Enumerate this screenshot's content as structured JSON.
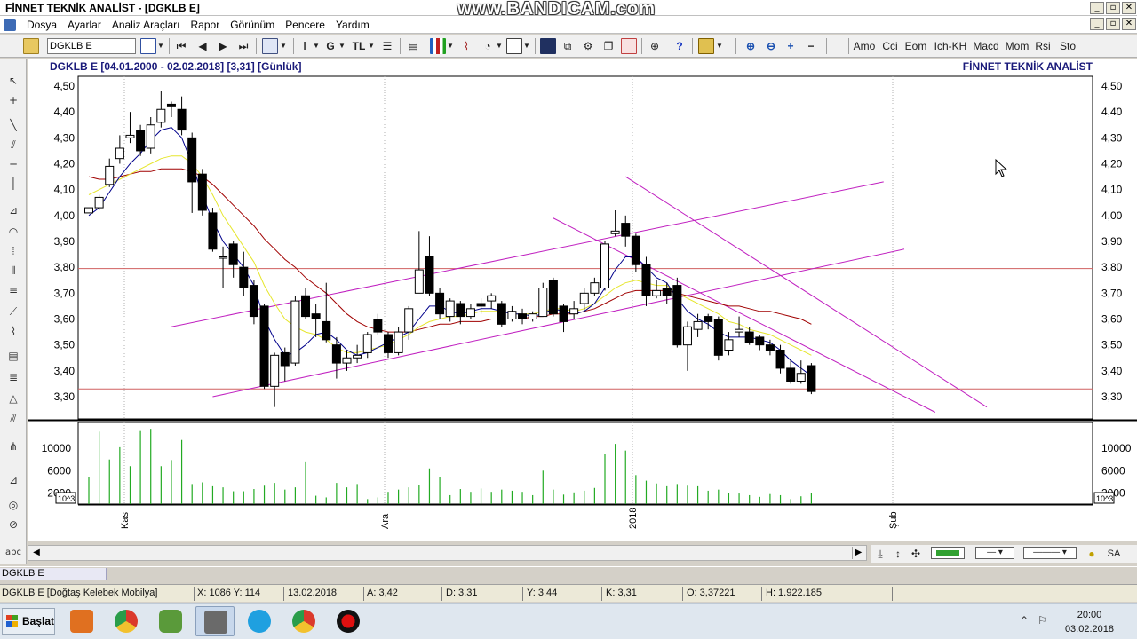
{
  "window": {
    "title": "FİNNET TEKNİK ANALİST - [DGKLB E]",
    "watermark": "www.BANDICAM.com",
    "buttons": [
      "_",
      "▫",
      "✕"
    ]
  },
  "menu": [
    "Dosya",
    "Ayarlar",
    "Analiz Araçları",
    "Rapor",
    "Görünüm",
    "Pencere",
    "Yardım"
  ],
  "toolbar": {
    "symbol_value": "DGKLB E",
    "g_label": "G",
    "tl_label": "TL",
    "indicators": [
      "Amo",
      "Cci",
      "Eom",
      "Ich-KH",
      "Macd",
      "Mom",
      "Rsi",
      "Sto"
    ]
  },
  "chart": {
    "header": "DGKLB E  [04.01.2000 - 02.02.2018]  [3,31]  [Günlük]",
    "brand": "FİNNET TEKNİK ANALİST",
    "colors": {
      "bear": "#000000",
      "bull": "#ffffff",
      "ma_fast": "#00008b",
      "ma_mid": "#e6e62e",
      "ma_slow": "#a00000",
      "trend": "#c020c0",
      "hline": "#d06060",
      "volume": "#22aa22"
    }
  },
  "chart_data": {
    "type": "candlestick",
    "price_axis": {
      "min": 3.3,
      "max": 4.5,
      "ticks": [
        "4,50",
        "4,40",
        "4,30",
        "4,20",
        "4,10",
        "4,00",
        "3,90",
        "3,80",
        "3,70",
        "3,60",
        "3,50",
        "3,40",
        "3,30"
      ]
    },
    "volume_axis": {
      "ticks": [
        "10000",
        "6000",
        "2000"
      ],
      "unit_label": "10^3"
    },
    "x_labels": [
      "Kas",
      "Ara",
      "2018",
      "Şub"
    ],
    "horizontal_lines": [
      3.795,
      3.33
    ],
    "candles": [
      [
        4.01,
        4.03,
        4.02,
        4.02
      ],
      [
        4.03,
        4.07,
        4.08,
        4.02
      ],
      [
        4.12,
        4.19,
        4.22,
        4.11
      ],
      [
        4.22,
        4.26,
        4.31,
        4.2
      ],
      [
        4.3,
        4.31,
        4.4,
        4.28
      ],
      [
        4.33,
        4.25,
        4.35,
        4.23
      ],
      [
        4.26,
        4.35,
        4.38,
        4.24
      ],
      [
        4.36,
        4.41,
        4.48,
        4.34
      ],
      [
        4.43,
        4.42,
        4.44,
        4.38
      ],
      [
        4.41,
        4.33,
        4.46,
        4.31
      ],
      [
        4.3,
        4.13,
        4.32,
        4.01
      ],
      [
        4.16,
        4.02,
        4.18,
        4.0
      ],
      [
        4.01,
        3.87,
        4.03,
        3.86
      ],
      [
        3.84,
        3.84,
        3.88,
        3.72
      ],
      [
        3.89,
        3.81,
        3.9,
        3.76
      ],
      [
        3.8,
        3.72,
        3.86,
        3.69
      ],
      [
        3.73,
        3.61,
        3.75,
        3.58
      ],
      [
        3.65,
        3.34,
        3.66,
        3.33
      ],
      [
        3.34,
        3.46,
        3.47,
        3.26
      ],
      [
        3.47,
        3.42,
        3.49,
        3.36
      ],
      [
        3.43,
        3.67,
        3.69,
        3.42
      ],
      [
        3.69,
        3.61,
        3.72,
        3.6
      ],
      [
        3.62,
        3.6,
        3.66,
        3.53
      ],
      [
        3.59,
        3.52,
        3.74,
        3.51
      ],
      [
        3.5,
        3.43,
        3.53,
        3.37
      ],
      [
        3.43,
        3.45,
        3.48,
        3.4
      ],
      [
        3.45,
        3.46,
        3.5,
        3.43
      ],
      [
        3.47,
        3.54,
        3.55,
        3.45
      ],
      [
        3.6,
        3.55,
        3.62,
        3.54
      ],
      [
        3.54,
        3.47,
        3.55,
        3.45
      ],
      [
        3.47,
        3.55,
        3.57,
        3.46
      ],
      [
        3.55,
        3.64,
        3.65,
        3.52
      ],
      [
        3.7,
        3.79,
        3.94,
        3.7
      ],
      [
        3.84,
        3.7,
        3.92,
        3.69
      ],
      [
        3.7,
        3.62,
        3.72,
        3.6
      ],
      [
        3.61,
        3.67,
        3.68,
        3.59
      ],
      [
        3.66,
        3.61,
        3.67,
        3.58
      ],
      [
        3.61,
        3.64,
        3.66,
        3.6
      ],
      [
        3.66,
        3.65,
        3.68,
        3.62
      ],
      [
        3.67,
        3.69,
        3.7,
        3.64
      ],
      [
        3.66,
        3.58,
        3.67,
        3.57
      ],
      [
        3.6,
        3.63,
        3.65,
        3.59
      ],
      [
        3.62,
        3.6,
        3.64,
        3.58
      ],
      [
        3.6,
        3.62,
        3.63,
        3.59
      ],
      [
        3.61,
        3.72,
        3.74,
        3.61
      ],
      [
        3.75,
        3.62,
        3.76,
        3.61
      ],
      [
        3.65,
        3.59,
        3.66,
        3.55
      ],
      [
        3.62,
        3.64,
        3.67,
        3.6
      ],
      [
        3.66,
        3.7,
        3.72,
        3.63
      ],
      [
        3.7,
        3.74,
        3.76,
        3.69
      ],
      [
        3.72,
        3.89,
        3.9,
        3.71
      ],
      [
        3.93,
        3.94,
        4.02,
        3.92
      ],
      [
        3.97,
        3.92,
        4.0,
        3.88
      ],
      [
        3.92,
        3.81,
        3.93,
        3.78
      ],
      [
        3.81,
        3.69,
        3.84,
        3.65
      ],
      [
        3.69,
        3.71,
        3.75,
        3.68
      ],
      [
        3.72,
        3.69,
        3.74,
        3.66
      ],
      [
        3.73,
        3.5,
        3.76,
        3.49
      ],
      [
        3.5,
        3.57,
        3.59,
        3.4
      ],
      [
        3.56,
        3.59,
        3.62,
        3.53
      ],
      [
        3.61,
        3.59,
        3.62,
        3.56
      ],
      [
        3.6,
        3.46,
        3.61,
        3.44
      ],
      [
        3.48,
        3.52,
        3.55,
        3.46
      ],
      [
        3.55,
        3.56,
        3.61,
        3.53
      ],
      [
        3.55,
        3.51,
        3.57,
        3.5
      ],
      [
        3.53,
        3.5,
        3.54,
        3.48
      ],
      [
        3.5,
        3.48,
        3.52,
        3.46
      ],
      [
        3.48,
        3.41,
        3.5,
        3.39
      ],
      [
        3.41,
        3.36,
        3.44,
        3.35
      ],
      [
        3.36,
        3.39,
        3.44,
        3.35
      ],
      [
        3.42,
        3.32,
        3.43,
        3.31
      ]
    ],
    "ma_fast": [
      4.0,
      4.03,
      4.09,
      4.15,
      4.2,
      4.24,
      4.29,
      4.33,
      4.34,
      4.3,
      4.2,
      4.08,
      3.98,
      3.9,
      3.85,
      3.8,
      3.73,
      3.6,
      3.52,
      3.46,
      3.47,
      3.5,
      3.54,
      3.55,
      3.52,
      3.48,
      3.46,
      3.47,
      3.49,
      3.51,
      3.53,
      3.55,
      3.6,
      3.65,
      3.65,
      3.63,
      3.62,
      3.63,
      3.64,
      3.64,
      3.63,
      3.62,
      3.62,
      3.61,
      3.62,
      3.64,
      3.63,
      3.62,
      3.63,
      3.66,
      3.72,
      3.79,
      3.84,
      3.84,
      3.8,
      3.76,
      3.74,
      3.68,
      3.63,
      3.6,
      3.58,
      3.55,
      3.53,
      3.53,
      3.53,
      3.52,
      3.51,
      3.48,
      3.44,
      3.41,
      3.38
    ],
    "ma_mid": [
      4.08,
      4.1,
      4.12,
      4.14,
      4.16,
      4.18,
      4.2,
      4.22,
      4.23,
      4.23,
      4.2,
      4.15,
      4.08,
      4.0,
      3.94,
      3.88,
      3.82,
      3.73,
      3.66,
      3.6,
      3.57,
      3.55,
      3.54,
      3.52,
      3.49,
      3.47,
      3.47,
      3.48,
      3.49,
      3.5,
      3.52,
      3.54,
      3.57,
      3.59,
      3.6,
      3.61,
      3.61,
      3.62,
      3.63,
      3.63,
      3.63,
      3.62,
      3.62,
      3.62,
      3.63,
      3.64,
      3.64,
      3.63,
      3.64,
      3.66,
      3.69,
      3.72,
      3.74,
      3.75,
      3.74,
      3.73,
      3.73,
      3.7,
      3.68,
      3.66,
      3.64,
      3.62,
      3.59,
      3.58,
      3.56,
      3.55,
      3.54,
      3.52,
      3.5,
      3.48,
      3.46
    ],
    "ma_slow": [
      4.15,
      4.14,
      4.14,
      4.15,
      4.16,
      4.17,
      4.17,
      4.18,
      4.18,
      4.18,
      4.17,
      4.15,
      4.12,
      4.08,
      4.04,
      4.0,
      3.96,
      3.91,
      3.87,
      3.83,
      3.8,
      3.76,
      3.73,
      3.7,
      3.66,
      3.62,
      3.59,
      3.57,
      3.56,
      3.55,
      3.55,
      3.55,
      3.56,
      3.57,
      3.58,
      3.58,
      3.59,
      3.59,
      3.59,
      3.6,
      3.6,
      3.6,
      3.6,
      3.61,
      3.61,
      3.62,
      3.62,
      3.62,
      3.63,
      3.64,
      3.66,
      3.68,
      3.7,
      3.71,
      3.71,
      3.71,
      3.71,
      3.7,
      3.69,
      3.68,
      3.67,
      3.66,
      3.65,
      3.65,
      3.64,
      3.63,
      3.63,
      3.62,
      3.61,
      3.6,
      3.58
    ],
    "volume": [
      4800,
      13000,
      8000,
      10200,
      6800,
      13100,
      13500,
      6800,
      7900,
      11500,
      3600,
      3900,
      3200,
      3000,
      2300,
      2300,
      2700,
      3300,
      3800,
      2600,
      3000,
      7500,
      1500,
      1200,
      3800,
      3000,
      3600,
      900,
      1200,
      2200,
      2600,
      3000,
      3400,
      6400,
      4800,
      1600,
      2700,
      2200,
      2800,
      2200,
      2600,
      2400,
      2200,
      1600,
      6000,
      2600,
      1700,
      2100,
      2400,
      2900,
      9000,
      10800,
      9600,
      5200,
      4200,
      3700,
      3200,
      3600,
      3300,
      3200,
      2400,
      2600,
      2000,
      1900,
      1600,
      1300,
      1800,
      1600,
      900,
      1400,
      2000
    ]
  },
  "status": {
    "symbol_tab": "DGKLB E",
    "name": "DGKLB E [Doğtaş Kelebek Mobilya]",
    "xy": "X: 1086 Y: 114",
    "date": "13.02.2018",
    "a": "A: 3,42",
    "d": "D: 3,31",
    "y": "Y: 3,44",
    "k": "K: 3,31",
    "o": "O: 3,37221",
    "h": "H: 1.922.185"
  },
  "right_controls": {
    "sa": "SA"
  },
  "taskbar": {
    "start": "Başlat",
    "time": "20:00",
    "date": "03.02.2018"
  }
}
